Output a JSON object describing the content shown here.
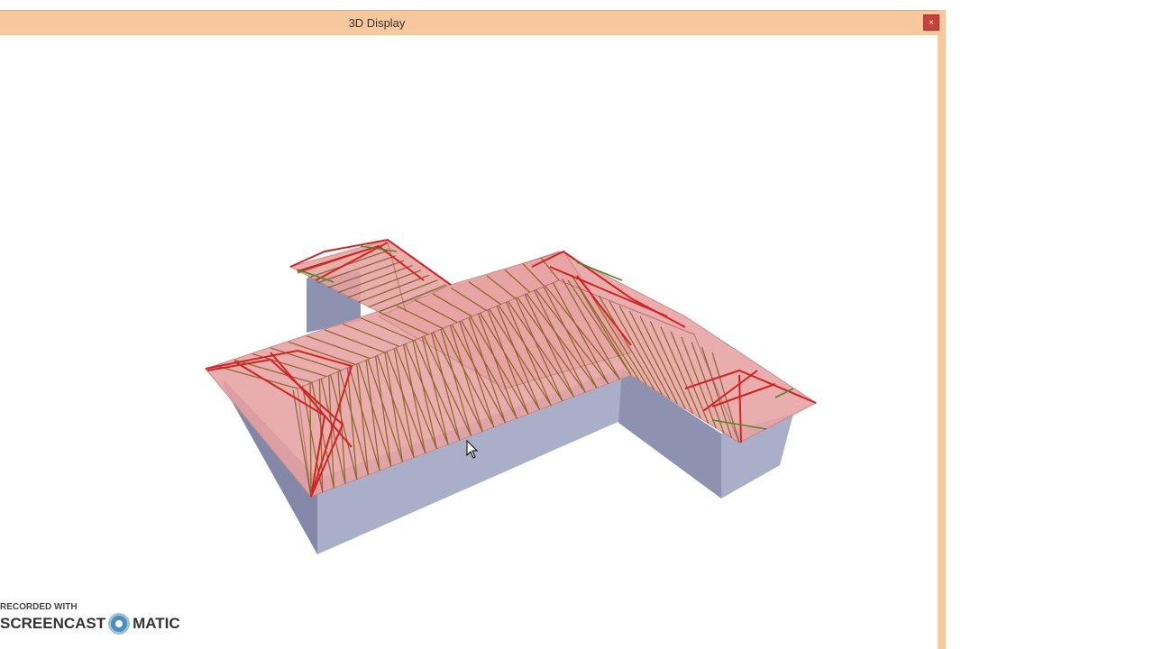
{
  "window": {
    "title": "3D Display",
    "close_label": "×"
  },
  "viewport": {
    "content": "3D roof truss model"
  },
  "watermark": {
    "line1": "RECORDED WITH",
    "left": "SCREENCAST",
    "right": "MATIC"
  },
  "colors": {
    "titlebar": "#f7c89d",
    "close": "#c7413a",
    "wall": "#a9aec9",
    "roof": "#e7a2a2",
    "truss_red": "#d42222",
    "truss_brown": "#7a5a12",
    "truss_green": "#4a8a24"
  }
}
